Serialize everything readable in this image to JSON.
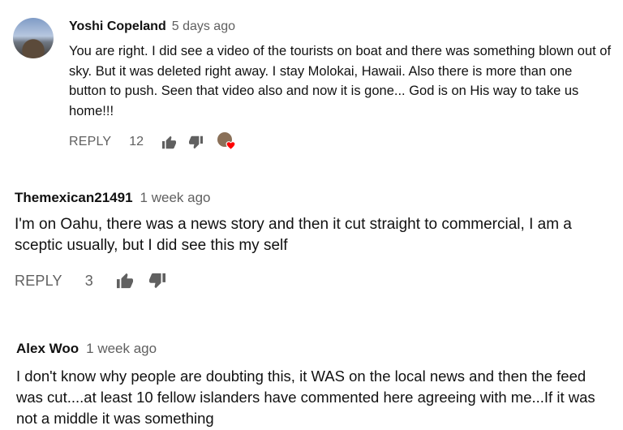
{
  "comments": [
    {
      "author": "Yoshi Copeland",
      "time": "5 days ago",
      "text": "You are right. I did see a video of the tourists on boat and there was something blown out of sky. But it was deleted right away. I stay Molokai, Hawaii. Also there is  more than one button to push. Seen that video also and now it is gone... God is on His way to take us home!!!",
      "reply_label": "REPLY",
      "likes": "12",
      "icons": [
        "thumbs-up-icon",
        "thumbs-down-icon",
        "creator-heart-icon"
      ]
    },
    {
      "author": "Themexican21491",
      "time": "1 week ago",
      "text": "I'm on Oahu, there was a news story and then it cut straight to commercial, I am a sceptic usually, but I did see this my self",
      "reply_label": "REPLY",
      "likes": "3",
      "icons": [
        "thumbs-up-icon",
        "thumbs-down-icon"
      ]
    },
    {
      "author": "Alex Woo",
      "time": "1 week ago",
      "text": "I don't know why people are doubting this, it WAS on the local news and then the feed was cut....at least 10 fellow islanders have commented here agreeing with me...If it was not a middle it was something"
    }
  ],
  "colors": {
    "heart": "#ff0000",
    "meta": "#606060",
    "text": "#111111"
  }
}
